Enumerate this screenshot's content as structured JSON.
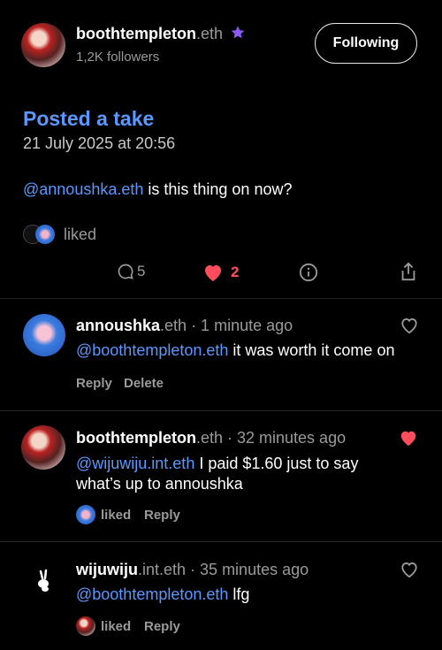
{
  "header": {
    "username": "boothtempleton",
    "username_suffix": ".eth",
    "followers": "1,2K followers",
    "follow_button": "Following"
  },
  "post": {
    "title": "Posted a take",
    "timestamp": "21 July 2025 at 20:56",
    "mention": "@annoushka.eth",
    "text": " is this thing on now?",
    "liked_label": "liked",
    "stats": {
      "comments": "5",
      "likes": "2"
    }
  },
  "comments": [
    {
      "user": "annoushka",
      "suffix": ".eth",
      "time": " · 1 minute ago",
      "mention": "@boothtempleton.eth",
      "text": " it was worth it come on",
      "actions": [
        "Reply",
        "Delete"
      ],
      "liked": false
    },
    {
      "user": "boothtempleton",
      "suffix": ".eth",
      "time": " · 32 minutes ago",
      "mention": "@wijuwiju.int.eth",
      "text_line1": " I paid $1.60 just to say",
      "text_line2": "what’s up to annoushka",
      "liked_label": "liked",
      "reply": "Reply",
      "liked": true
    },
    {
      "user": "wijuwiju",
      "suffix": ".int.eth",
      "time": " · 35 minutes ago",
      "mention": "@boothtempleton.eth",
      "text": " lfg",
      "liked_label": "liked",
      "reply": "Reply",
      "liked": false
    }
  ],
  "colors": {
    "accent": "#5a97ff",
    "like": "#ff4d5e",
    "badge": "#8b5cf6",
    "background": "#000000"
  }
}
